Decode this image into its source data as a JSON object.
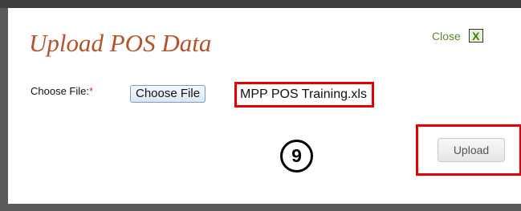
{
  "dialog": {
    "title": "Upload POS Data",
    "close_label": "Close",
    "close_icon_glyph": "X",
    "close_icon": "close-x-icon"
  },
  "form": {
    "file_label": "Choose File:",
    "required_marker": "*",
    "choose_button_label": "Choose File",
    "selected_file": "MPP POS Training.xls",
    "upload_button_label": "Upload"
  },
  "annotation": {
    "step_number": "9",
    "highlight_color": "#e60000"
  },
  "colors": {
    "title": "#b4532b",
    "close_link": "#5b8a2a"
  }
}
